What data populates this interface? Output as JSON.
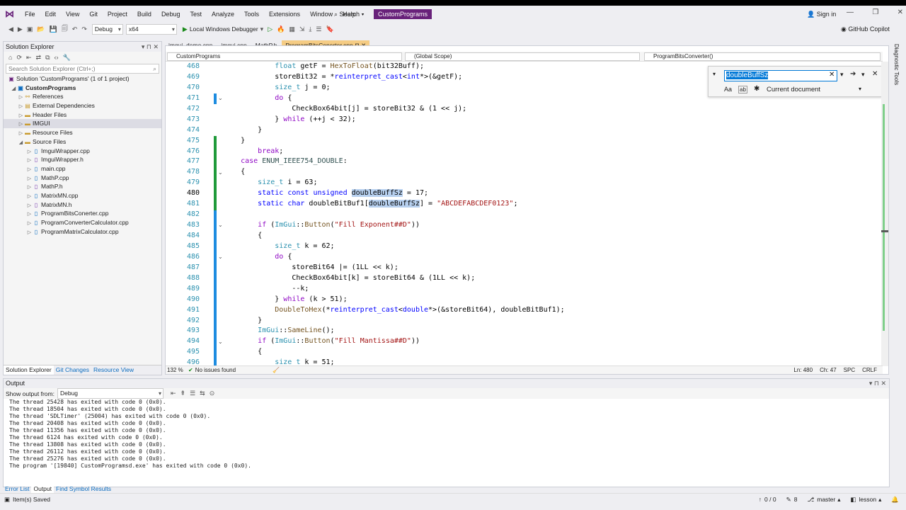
{
  "menubar": {
    "items": [
      "File",
      "Edit",
      "View",
      "Git",
      "Project",
      "Build",
      "Debug",
      "Test",
      "Analyze",
      "Tools",
      "Extensions",
      "Window",
      "Help"
    ],
    "search": "Search",
    "project_badge": "CustomPrograms",
    "sign_in": "Sign in"
  },
  "toolbar": {
    "config": "Debug",
    "platform": "x64",
    "debugger": "Local Windows Debugger",
    "copilot": "GitHub Copilot"
  },
  "solution_explorer": {
    "title": "Solution Explorer",
    "search_placeholder": "Search Solution Explorer (Ctrl+;)",
    "solution": "Solution 'CustomPrograms' (1 of 1 project)",
    "project": "CustomPrograms",
    "items": [
      {
        "label": "References",
        "indent": 2
      },
      {
        "label": "External Dependencies",
        "indent": 2
      },
      {
        "label": "Header Files",
        "indent": 2
      },
      {
        "label": "IMGUI",
        "indent": 2
      },
      {
        "label": "Resource Files",
        "indent": 2
      },
      {
        "label": "Source Files",
        "indent": 2
      },
      {
        "label": "ImguiWrapper.cpp",
        "indent": 3
      },
      {
        "label": "ImguiWrapper.h",
        "indent": 3
      },
      {
        "label": "main.cpp",
        "indent": 3
      },
      {
        "label": "MathP.cpp",
        "indent": 3
      },
      {
        "label": "MathP.h",
        "indent": 3
      },
      {
        "label": "MatrixMN.cpp",
        "indent": 3
      },
      {
        "label": "MatrixMN.h",
        "indent": 3
      },
      {
        "label": "ProgramBitsConerter.cpp",
        "indent": 3
      },
      {
        "label": "ProgramConverterCalculator.cpp",
        "indent": 3
      },
      {
        "label": "ProgramMatrixCalculator.cpp",
        "indent": 3
      }
    ],
    "tabs": [
      "Solution Explorer",
      "Git Changes",
      "Resource View"
    ]
  },
  "editor": {
    "tabs": [
      "imgui_demo.cpp",
      "imgui.cpp",
      "MathP.h",
      "ProgramBitsConerter.cpp"
    ],
    "nav": [
      "CustomPrograms",
      "(Global Scope)",
      "ProgramBitsConverter()"
    ],
    "line_numbers": [
      "468",
      "469",
      "470",
      "471",
      "472",
      "473",
      "474",
      "475",
      "476",
      "477",
      "478",
      "479",
      "480",
      "481",
      "482",
      "483",
      "484",
      "485",
      "486",
      "487",
      "488",
      "489",
      "490",
      "491",
      "492",
      "493",
      "494",
      "495",
      "496"
    ],
    "find_text": "doubleBuffSz",
    "find_scope": "Current document",
    "zoom": "132 %",
    "issues": "No issues found",
    "position": "Ln: 480",
    "column": "Ch: 47",
    "spc": "SPC",
    "eol": "CRLF"
  },
  "output": {
    "title": "Output",
    "show_from_label": "Show output from:",
    "source": "Debug",
    "lines": [
      "The thread 25428 has exited with code 0 (0x0).",
      "The thread 18504 has exited with code 0 (0x0).",
      "The thread 'SDLTimer' (25004) has exited with code 0 (0x0).",
      "The thread 20408 has exited with code 0 (0x0).",
      "The thread 11356 has exited with code 0 (0x0).",
      "The thread 6124 has exited with code 0 (0x0).",
      "The thread 13808 has exited with code 0 (0x0).",
      "The thread 26112 has exited with code 0 (0x0).",
      "The thread 25276 has exited with code 0 (0x0).",
      "The program '[19840] CustomProgramsd.exe' has exited with code 0 (0x0)."
    ],
    "tabs": [
      "Error List",
      "Output",
      "Find Symbol Results"
    ]
  },
  "statusbar": {
    "left": "Item(s) Saved",
    "counts": "0 / 0",
    "pencil": "8",
    "branch": "master",
    "repo": "lesson"
  },
  "diagnostic_label": "Diagnostic Tools",
  "colors": {
    "accent": "#68217a",
    "active_tab": "#f5cc84",
    "keyword": "#0000ff",
    "type": "#2b91af",
    "string": "#a31515"
  }
}
